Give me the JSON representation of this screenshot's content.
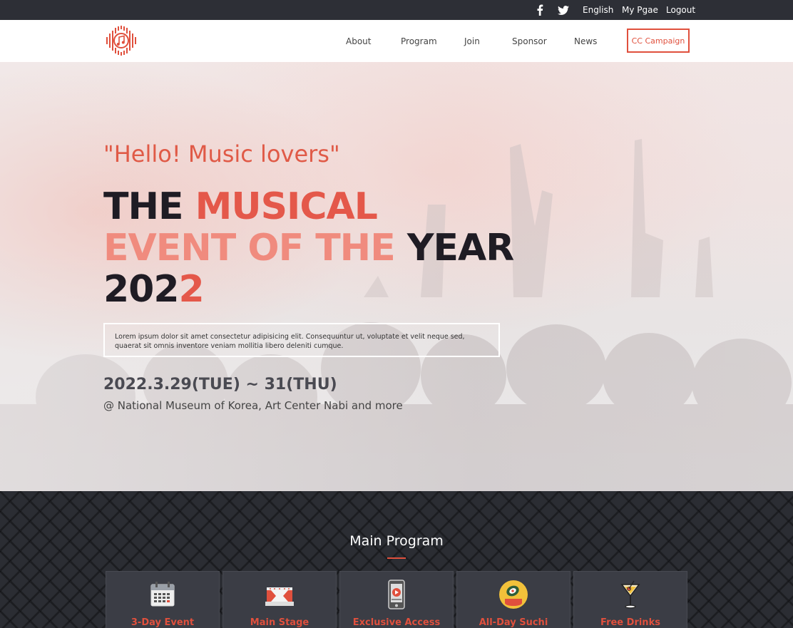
{
  "topbar": {
    "social": [
      {
        "icon": "facebook-icon"
      },
      {
        "icon": "twitter-icon"
      }
    ],
    "links": {
      "language": "English",
      "my_page": "My Pgae",
      "logout": "Logout"
    }
  },
  "nav": {
    "logo_icon": "music-logo-icon",
    "items": [
      "About",
      "Program",
      "Join",
      "Sponsor",
      "News"
    ],
    "campaign_button": "CC Campaign"
  },
  "hero": {
    "greeting": "\"Hello! Music lovers\"",
    "headline": {
      "line1_a": "THE ",
      "line1_b": "MUSICAL",
      "line2_a": "EVENT OF THE ",
      "line2_b": "YEAR",
      "line3_a": "202",
      "line3_b": "2"
    },
    "description": "Lorem ipsum dolor sit amet consectetur adipisicing elit. Consequuntur ut, voluptate et velit neque sed, quaerat sit omnis inventore veniam mollitia libero deleniti cumque.",
    "date": "2022.3.29(TUE) ~ 31(THU)",
    "venue": "@ National Museum of Korea, Art Center Nabi and more"
  },
  "program": {
    "title": "Main Program",
    "cards": [
      {
        "label": "3-Day Event",
        "icon": "calendar-icon"
      },
      {
        "label": "Main Stage",
        "icon": "stage-icon"
      },
      {
        "label": "Exclusive Access",
        "icon": "phone-play-icon"
      },
      {
        "label": "All-Day Suchi",
        "icon": "sushi-icon"
      },
      {
        "label": "Free Drinks",
        "icon": "cocktail-icon"
      }
    ]
  },
  "colors": {
    "accent": "#e0503d",
    "dark_bar": "#2d2f36",
    "headline_dark": "#1f1c24"
  }
}
